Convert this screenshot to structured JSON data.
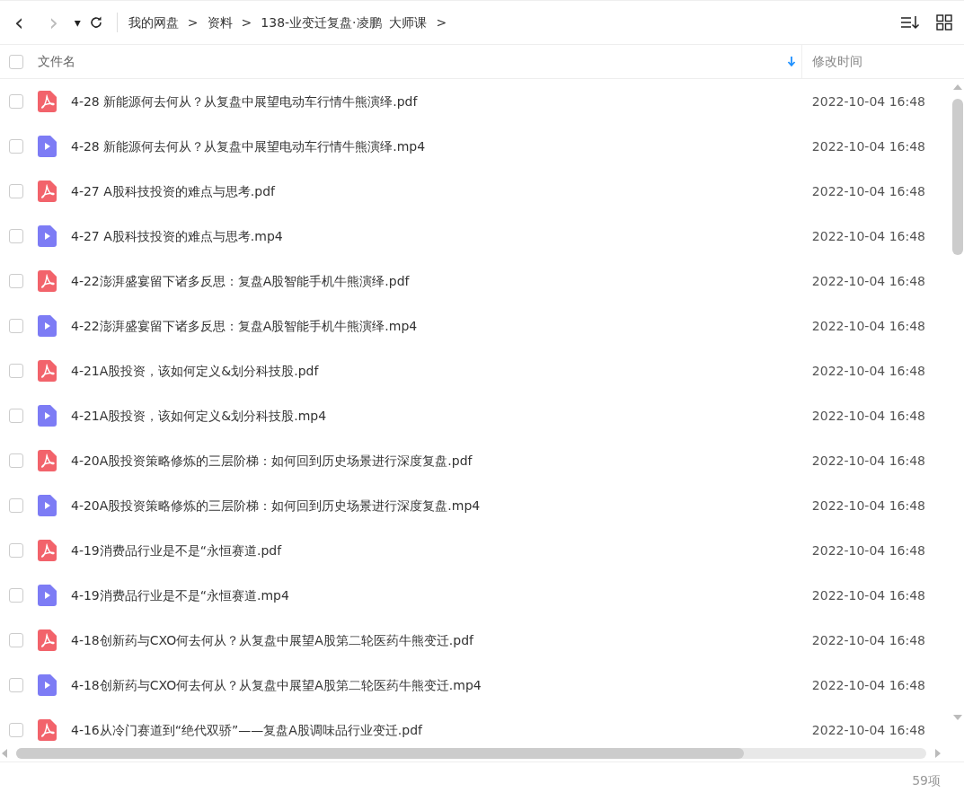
{
  "toolbar": {
    "back": "‹",
    "forward": "›",
    "dropdown": "▾",
    "breadcrumbs": [
      {
        "label": "我的网盘"
      },
      {
        "label": "资料"
      },
      {
        "label": "138-业变迁复盘·凌鹏  大师课"
      }
    ],
    "separator": ">"
  },
  "select_all": {
    "checked": false
  },
  "columns": [
    {
      "label": "文件名",
      "sorted": true
    },
    {
      "label": "修改时间",
      "sorted": false
    }
  ],
  "files": [
    {
      "kind": "pdf",
      "name": "4-28 新能源何去何从？从复盘中展望电动车行情牛熊演绎.pdf",
      "modified": "2022-10-04 16:48",
      "checked": false
    },
    {
      "kind": "video",
      "name": "4-28 新能源何去何从？从复盘中展望电动车行情牛熊演绎.mp4",
      "modified": "2022-10-04 16:48",
      "checked": false
    },
    {
      "kind": "pdf",
      "name": "4-27 A股科技投资的难点与思考.pdf",
      "modified": "2022-10-04 16:48",
      "checked": false
    },
    {
      "kind": "video",
      "name": "4-27 A股科技投资的难点与思考.mp4",
      "modified": "2022-10-04 16:48",
      "checked": false
    },
    {
      "kind": "pdf",
      "name": "4-22澎湃盛宴留下诸多反思：复盘A股智能手机牛熊演绎.pdf",
      "modified": "2022-10-04 16:48",
      "checked": false
    },
    {
      "kind": "video",
      "name": "4-22澎湃盛宴留下诸多反思：复盘A股智能手机牛熊演绎.mp4",
      "modified": "2022-10-04 16:48",
      "checked": false
    },
    {
      "kind": "pdf",
      "name": "4-21A股投资，该如何定义&划分科技股.pdf",
      "modified": "2022-10-04 16:48",
      "checked": false
    },
    {
      "kind": "video",
      "name": "4-21A股投资，该如何定义&划分科技股.mp4",
      "modified": "2022-10-04 16:48",
      "checked": false
    },
    {
      "kind": "pdf",
      "name": "4-20A股投资策略修炼的三层阶梯：如何回到历史场景进行深度复盘.pdf",
      "modified": "2022-10-04 16:48",
      "checked": false
    },
    {
      "kind": "video",
      "name": "4-20A股投资策略修炼的三层阶梯：如何回到历史场景进行深度复盘.mp4",
      "modified": "2022-10-04 16:48",
      "checked": false
    },
    {
      "kind": "pdf",
      "name": "4-19消费品行业是不是“永恒赛道.pdf",
      "modified": "2022-10-04 16:48",
      "checked": false
    },
    {
      "kind": "video",
      "name": "4-19消费品行业是不是“永恒赛道.mp4",
      "modified": "2022-10-04 16:48",
      "checked": false
    },
    {
      "kind": "pdf",
      "name": "4-18创新药与CXO何去何从？从复盘中展望A股第二轮医药牛熊变迁.pdf",
      "modified": "2022-10-04 16:48",
      "checked": false
    },
    {
      "kind": "video",
      "name": "4-18创新药与CXO何去何从？从复盘中展望A股第二轮医药牛熊变迁.mp4",
      "modified": "2022-10-04 16:48",
      "checked": false
    },
    {
      "kind": "pdf",
      "name": "4-16从冷门赛道到“绝代双骄”——复盘A股调味品行业变迁.pdf",
      "modified": "2022-10-04 16:48",
      "checked": false
    }
  ],
  "status_bar": {
    "count": "59项"
  }
}
